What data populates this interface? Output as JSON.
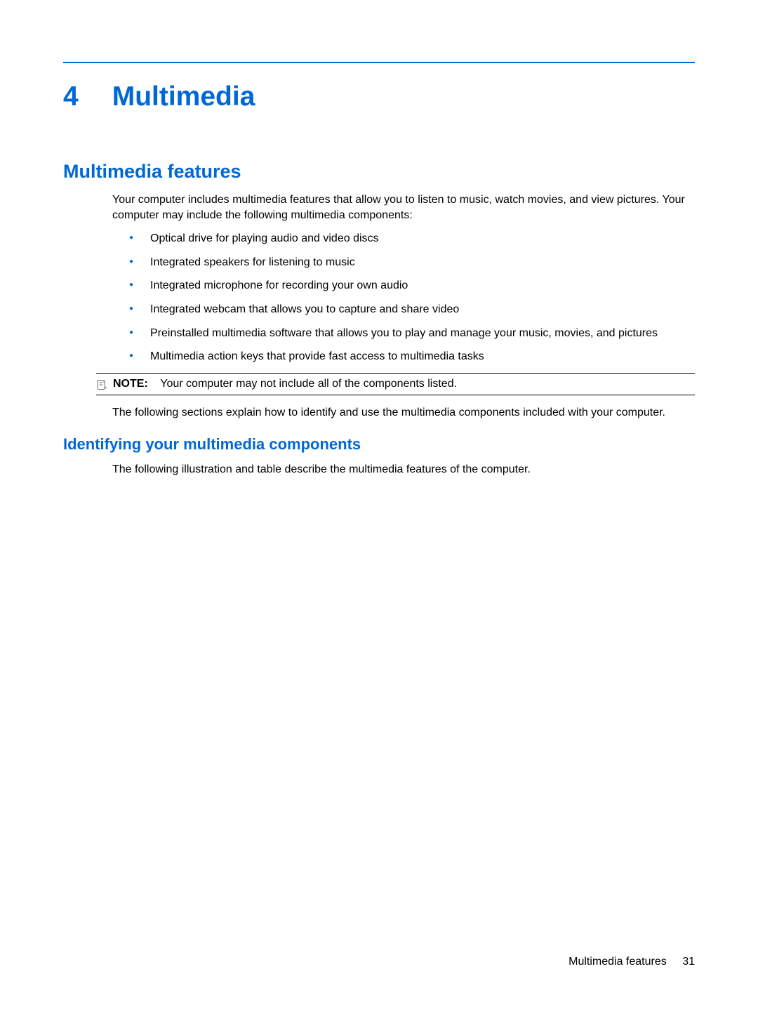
{
  "chapter": {
    "number": "4",
    "title": "Multimedia"
  },
  "section": {
    "heading": "Multimedia features",
    "intro": "Your computer includes multimedia features that allow you to listen to music, watch movies, and view pictures. Your computer may include the following multimedia components:",
    "bullets": [
      "Optical drive for playing audio and video discs",
      "Integrated speakers for listening to music",
      "Integrated microphone for recording your own audio",
      "Integrated webcam that allows you to capture and share video",
      "Preinstalled multimedia software that allows you to play and manage your music, movies, and pictures",
      "Multimedia action keys that provide fast access to multimedia tasks"
    ],
    "note_label": "NOTE:",
    "note_text": "Your computer may not include all of the components listed.",
    "after_note": "The following sections explain how to identify and use the multimedia components included with your computer."
  },
  "subsection": {
    "heading": "Identifying your multimedia components",
    "text": "The following illustration and table describe the multimedia features of the computer."
  },
  "footer": {
    "label": "Multimedia features",
    "page": "31"
  }
}
